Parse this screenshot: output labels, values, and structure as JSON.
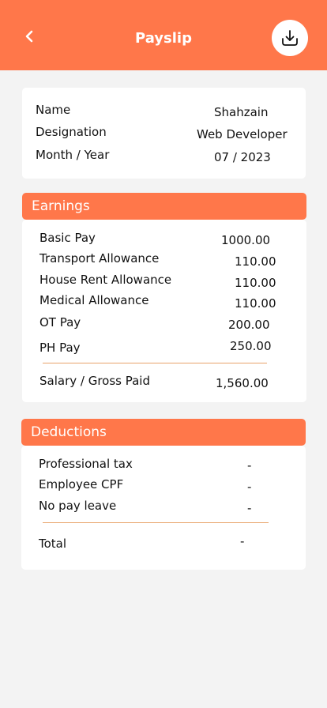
{
  "header": {
    "title": "Payslip",
    "back_icon": "chevron-left-icon",
    "download_icon": "download-icon"
  },
  "colors": {
    "accent": "#ff774a",
    "background": "#f3f3f3",
    "divider": "#e8a36a"
  },
  "employee": {
    "name_label": "Name",
    "name_value": "Shahzain",
    "designation_label": "Designation",
    "designation_value": "Web Developer",
    "period_label": "Month / Year",
    "period_value": "07 / 2023"
  },
  "earnings": {
    "title": "Earnings",
    "items": [
      {
        "label": "Basic Pay",
        "value": "1000.00"
      },
      {
        "label": "Transport Allowance",
        "value": "110.00"
      },
      {
        "label": "House Rent Allowance",
        "value": "110.00"
      },
      {
        "label": "Medical Allowance",
        "value": "110.00"
      },
      {
        "label": "OT Pay",
        "value": "200.00"
      },
      {
        "label": "PH Pay",
        "value": "250.00"
      }
    ],
    "total_label": "Salary / Gross Paid",
    "total_value": "1,560.00"
  },
  "deductions": {
    "title": "Deductions",
    "items": [
      {
        "label": "Professional tax",
        "value": "-"
      },
      {
        "label": "Employee CPF",
        "value": "-"
      },
      {
        "label": "No pay leave",
        "value": "-"
      }
    ],
    "total_label": "Total",
    "total_value": "-"
  }
}
